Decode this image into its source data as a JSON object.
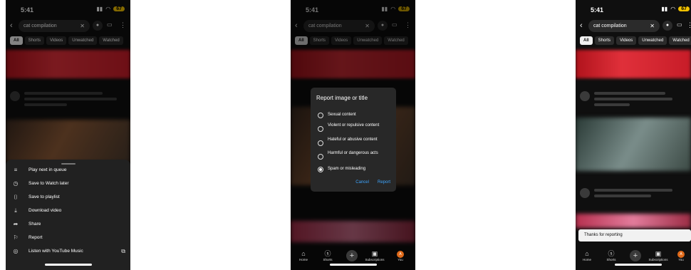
{
  "status": {
    "time": "5:41",
    "battery": "67"
  },
  "search": {
    "query": "cat compilation"
  },
  "chips": [
    "All",
    "Shorts",
    "Videos",
    "Unwatched",
    "Watched"
  ],
  "menu": {
    "items": [
      {
        "icon": "queue-icon",
        "label": "Play next in queue"
      },
      {
        "icon": "clock-icon",
        "label": "Save to Watch later"
      },
      {
        "icon": "bookmark-icon",
        "label": "Save to playlist"
      },
      {
        "icon": "download-icon",
        "label": "Download video"
      },
      {
        "icon": "share-icon",
        "label": "Share"
      },
      {
        "icon": "flag-icon",
        "label": "Report"
      },
      {
        "icon": "music-icon",
        "label": "Listen with YouTube Music"
      }
    ]
  },
  "dialog": {
    "title": "Report image or title",
    "options": [
      "Sexual content",
      "Violent or repulsive content",
      "Hateful or abusive content",
      "Harmful or dangerous acts",
      "Spam or misleading"
    ],
    "selected": "Spam or misleading",
    "cancel": "Cancel",
    "report": "Report"
  },
  "nav": {
    "home": "Home",
    "shorts": "Shorts",
    "subscriptions": "Subscriptions",
    "you": "You"
  },
  "toast": "Thanks for reporting"
}
